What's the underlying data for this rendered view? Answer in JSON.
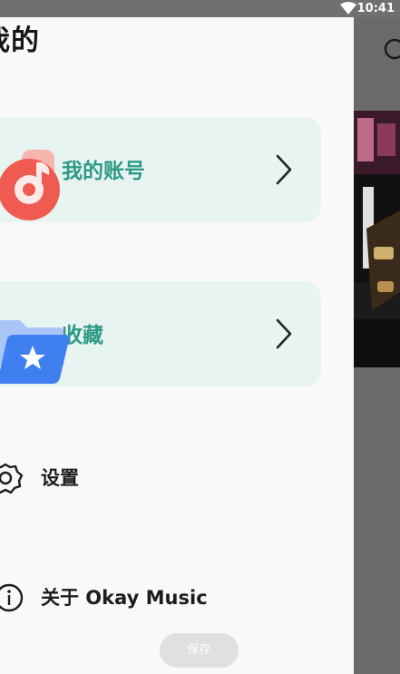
{
  "status_bar": {
    "time": "10:41",
    "wifi_icon": "wifi-icon"
  },
  "drawer": {
    "title": "我的",
    "account_card": {
      "label": "我的账号",
      "icon": "music-note-app-icon",
      "chevron": "chevron-right-icon"
    },
    "favorites_card": {
      "label": "收藏",
      "icon": "star-folder-icon",
      "chevron": "chevron-right-icon"
    },
    "settings": {
      "label": "设置",
      "icon": "gear-icon"
    },
    "about": {
      "label": "关于 Okay Music",
      "icon": "info-icon"
    },
    "save_button": "保存"
  },
  "background_app": {
    "search_icon": "search-icon"
  },
  "colors": {
    "card_bg": "#e8f4f1",
    "card_label": "#2d9a86",
    "drawer_bg": "#f9f9f9",
    "overlay": "#6a6a6a",
    "music_icon": "#ef5b50",
    "folder_icon": "#3f7ff0"
  }
}
